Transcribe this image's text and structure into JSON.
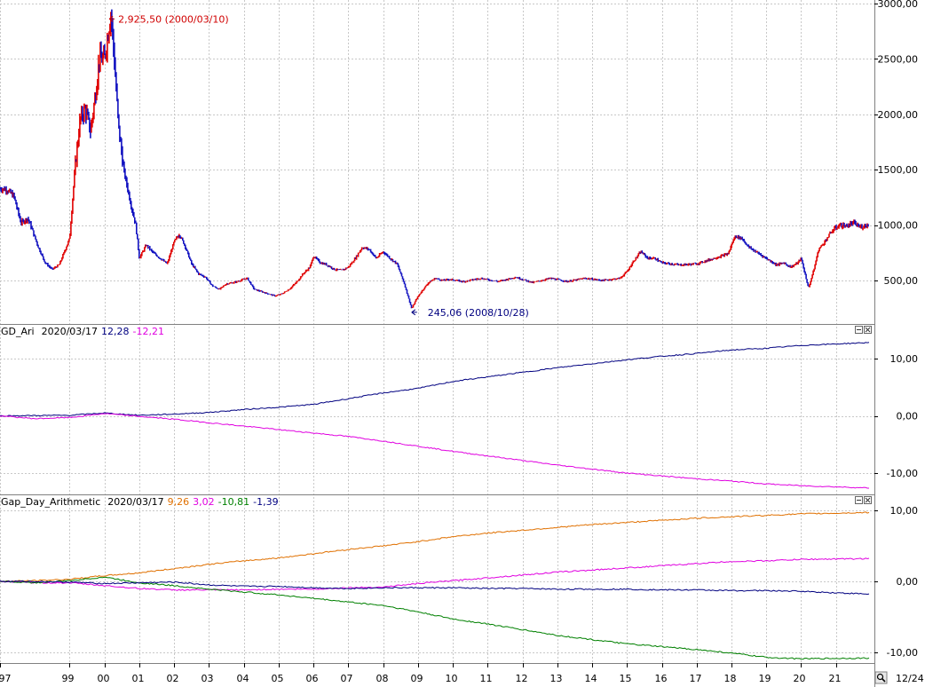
{
  "colors": {
    "grid": "#c8c8c8",
    "up": "#e00000",
    "down": "#1010c0",
    "blue": "#000080",
    "magenta": "#e000e0",
    "orange": "#e07000",
    "green": "#008000",
    "text": "#000000",
    "panel_border": "#808080"
  },
  "footer": {
    "date": "12/24",
    "zoom_icon": "magnifier-icon"
  },
  "chart_data": [
    {
      "type": "candlestick",
      "panel": "price",
      "ylim": [
        200,
        3000
      ],
      "yticks": [
        500,
        1000,
        1500,
        2000,
        2500,
        3000
      ],
      "ytick_labels": [
        "500,00",
        "1000,00",
        "1500,00",
        "2000,00",
        "2500,00",
        "3000,00"
      ],
      "grid": true,
      "x_start": 1997.0,
      "x_end": 2021.95,
      "price_path": [
        [
          1997.0,
          1330
        ],
        [
          1997.2,
          1320
        ],
        [
          1997.4,
          1260
        ],
        [
          1997.6,
          1020
        ],
        [
          1997.8,
          1060
        ],
        [
          1997.9,
          980
        ],
        [
          1998.1,
          800
        ],
        [
          1998.3,
          660
        ],
        [
          1998.5,
          600
        ],
        [
          1998.7,
          640
        ],
        [
          1998.8,
          720
        ],
        [
          1999.0,
          880
        ],
        [
          1999.15,
          1500
        ],
        [
          1999.3,
          1950
        ],
        [
          1999.45,
          2050
        ],
        [
          1999.6,
          1850
        ],
        [
          1999.75,
          2200
        ],
        [
          1999.85,
          2500
        ],
        [
          2000.0,
          2500
        ],
        [
          2000.19,
          2925.5
        ],
        [
          2000.3,
          2400
        ],
        [
          2000.4,
          1900
        ],
        [
          2000.55,
          1500
        ],
        [
          2000.75,
          1200
        ],
        [
          2000.9,
          1000
        ],
        [
          2001.0,
          700
        ],
        [
          2001.2,
          820
        ],
        [
          2001.4,
          750
        ],
        [
          2001.6,
          700
        ],
        [
          2001.8,
          650
        ],
        [
          2002.0,
          850
        ],
        [
          2002.15,
          920
        ],
        [
          2002.3,
          820
        ],
        [
          2002.5,
          650
        ],
        [
          2002.7,
          560
        ],
        [
          2002.9,
          530
        ],
        [
          2003.1,
          450
        ],
        [
          2003.3,
          420
        ],
        [
          2003.5,
          470
        ],
        [
          2003.7,
          480
        ],
        [
          2003.9,
          500
        ],
        [
          2004.1,
          520
        ],
        [
          2004.3,
          420
        ],
        [
          2004.5,
          400
        ],
        [
          2004.7,
          380
        ],
        [
          2004.9,
          360
        ],
        [
          2005.1,
          380
        ],
        [
          2005.3,
          420
        ],
        [
          2005.5,
          480
        ],
        [
          2005.7,
          560
        ],
        [
          2005.9,
          620
        ],
        [
          2006.0,
          720
        ],
        [
          2006.2,
          660
        ],
        [
          2006.4,
          640
        ],
        [
          2006.6,
          600
        ],
        [
          2006.8,
          590
        ],
        [
          2007.0,
          620
        ],
        [
          2007.2,
          700
        ],
        [
          2007.4,
          800
        ],
        [
          2007.6,
          780
        ],
        [
          2007.8,
          700
        ],
        [
          2008.0,
          760
        ],
        [
          2008.2,
          700
        ],
        [
          2008.4,
          650
        ],
        [
          2008.6,
          480
        ],
        [
          2008.82,
          245.06
        ],
        [
          2008.95,
          330
        ],
        [
          2009.1,
          400
        ],
        [
          2009.3,
          480
        ],
        [
          2009.5,
          520
        ],
        [
          2009.7,
          500
        ],
        [
          2009.9,
          510
        ],
        [
          2010.3,
          490
        ],
        [
          2010.8,
          520
        ],
        [
          2011.3,
          490
        ],
        [
          2011.8,
          530
        ],
        [
          2012.3,
          480
        ],
        [
          2012.8,
          520
        ],
        [
          2013.3,
          490
        ],
        [
          2013.8,
          520
        ],
        [
          2014.3,
          500
        ],
        [
          2014.8,
          520
        ],
        [
          2015.0,
          580
        ],
        [
          2015.2,
          680
        ],
        [
          2015.4,
          760
        ],
        [
          2015.6,
          700
        ],
        [
          2015.8,
          700
        ],
        [
          2016.0,
          660
        ],
        [
          2016.5,
          640
        ],
        [
          2017.0,
          650
        ],
        [
          2017.5,
          700
        ],
        [
          2017.9,
          740
        ],
        [
          2018.1,
          900
        ],
        [
          2018.3,
          880
        ],
        [
          2018.5,
          800
        ],
        [
          2018.7,
          760
        ],
        [
          2018.9,
          720
        ],
        [
          2019.1,
          680
        ],
        [
          2019.3,
          640
        ],
        [
          2019.5,
          660
        ],
        [
          2019.7,
          620
        ],
        [
          2019.9,
          660
        ],
        [
          2020.0,
          700
        ],
        [
          2020.21,
          430
        ],
        [
          2020.35,
          580
        ],
        [
          2020.5,
          780
        ],
        [
          2020.7,
          860
        ],
        [
          2020.9,
          950
        ],
        [
          2021.1,
          1000
        ],
        [
          2021.3,
          990
        ],
        [
          2021.5,
          1020
        ],
        [
          2021.7,
          980
        ],
        [
          2021.95,
          1010
        ]
      ],
      "annotations": [
        {
          "text": "2,925,50 (2000/03/10)",
          "x": 2000.19,
          "y": 2925.5,
          "color": "#d00000"
        },
        {
          "text": "245,06 (2008/10/28)",
          "x": 2008.82,
          "y": 245.06,
          "color": "#000080"
        }
      ]
    },
    {
      "type": "line",
      "panel": "indicator1",
      "title": "GD_Ari",
      "date": "2020/03/17",
      "values_text": [
        "12,28",
        "-12,21"
      ],
      "value_colors": [
        "#000080",
        "#e000e0"
      ],
      "ylim": [
        -13.5,
        14.5
      ],
      "yticks": [
        -10,
        0,
        10
      ],
      "ytick_labels": [
        "-10,00",
        "0,00",
        "10,00"
      ],
      "series": [
        {
          "color": "#000080",
          "points": [
            [
              1997.0,
              0
            ],
            [
              1999.0,
              0.1
            ],
            [
              2000.0,
              0.5
            ],
            [
              2001.0,
              0.1
            ],
            [
              2002.0,
              0.3
            ],
            [
              2003.0,
              0.6
            ],
            [
              2004.0,
              1.1
            ],
            [
              2005.0,
              1.5
            ],
            [
              2006.0,
              2.0
            ],
            [
              2007.0,
              3.0
            ],
            [
              2008.0,
              4.0
            ],
            [
              2009.0,
              4.8
            ],
            [
              2010.0,
              6.0
            ],
            [
              2011.0,
              6.8
            ],
            [
              2012.0,
              7.6
            ],
            [
              2013.0,
              8.4
            ],
            [
              2014.0,
              9.1
            ],
            [
              2015.0,
              9.8
            ],
            [
              2016.0,
              10.4
            ],
            [
              2017.0,
              10.9
            ],
            [
              2018.0,
              11.5
            ],
            [
              2019.0,
              11.8
            ],
            [
              2020.0,
              12.3
            ],
            [
              2021.95,
              12.8
            ]
          ]
        },
        {
          "color": "#e000e0",
          "points": [
            [
              1997.0,
              0
            ],
            [
              1998.0,
              -0.5
            ],
            [
              1999.0,
              -0.3
            ],
            [
              2000.0,
              0.4
            ],
            [
              2001.0,
              -0.1
            ],
            [
              2002.0,
              -0.6
            ],
            [
              2003.0,
              -1.2
            ],
            [
              2004.0,
              -1.8
            ],
            [
              2005.0,
              -2.4
            ],
            [
              2006.0,
              -3.0
            ],
            [
              2007.0,
              -3.6
            ],
            [
              2008.0,
              -4.4
            ],
            [
              2009.0,
              -5.3
            ],
            [
              2010.0,
              -6.2
            ],
            [
              2011.0,
              -7.0
            ],
            [
              2012.0,
              -7.8
            ],
            [
              2013.0,
              -8.6
            ],
            [
              2014.0,
              -9.3
            ],
            [
              2015.0,
              -10.0
            ],
            [
              2016.0,
              -10.5
            ],
            [
              2017.0,
              -11.0
            ],
            [
              2018.0,
              -11.4
            ],
            [
              2019.0,
              -11.9
            ],
            [
              2020.0,
              -12.2
            ],
            [
              2021.95,
              -12.6
            ]
          ]
        }
      ]
    },
    {
      "type": "line",
      "panel": "indicator2",
      "title": "Gap_Day_Arithmetic",
      "date": "2020/03/17",
      "values_text": [
        "9,26",
        "3,02",
        "-10,81",
        "-1,39"
      ],
      "value_colors": [
        "#e07000",
        "#e000e0",
        "#008000",
        "#000080"
      ],
      "ylim": [
        -11.5,
        10.5
      ],
      "yticks": [
        -10,
        0,
        10
      ],
      "ytick_labels": [
        "-10,00",
        "0,00",
        "10,00"
      ],
      "series": [
        {
          "color": "#e07000",
          "points": [
            [
              1997.0,
              0
            ],
            [
              1998.0,
              0.1
            ],
            [
              1999.0,
              0.3
            ],
            [
              2000.0,
              0.8
            ],
            [
              2001.0,
              1.2
            ],
            [
              2002.0,
              1.8
            ],
            [
              2003.0,
              2.4
            ],
            [
              2004.0,
              2.9
            ],
            [
              2005.0,
              3.3
            ],
            [
              2006.0,
              3.9
            ],
            [
              2007.0,
              4.5
            ],
            [
              2008.0,
              5.0
            ],
            [
              2009.0,
              5.6
            ],
            [
              2010.0,
              6.3
            ],
            [
              2011.0,
              6.8
            ],
            [
              2012.0,
              7.2
            ],
            [
              2013.0,
              7.6
            ],
            [
              2014.0,
              8.0
            ],
            [
              2015.0,
              8.3
            ],
            [
              2016.0,
              8.6
            ],
            [
              2017.0,
              8.9
            ],
            [
              2018.0,
              9.1
            ],
            [
              2019.0,
              9.3
            ],
            [
              2020.0,
              9.5
            ],
            [
              2021.95,
              9.7
            ]
          ]
        },
        {
          "color": "#e000e0",
          "points": [
            [
              1997.0,
              0
            ],
            [
              1998.0,
              -0.2
            ],
            [
              1999.0,
              -0.2
            ],
            [
              2000.0,
              -0.6
            ],
            [
              2001.0,
              -1.0
            ],
            [
              2002.0,
              -1.2
            ],
            [
              2003.0,
              -1.2
            ],
            [
              2004.0,
              -1.2
            ],
            [
              2005.0,
              -1.1
            ],
            [
              2006.0,
              -1.1
            ],
            [
              2007.0,
              -0.9
            ],
            [
              2008.0,
              -0.8
            ],
            [
              2009.0,
              -0.3
            ],
            [
              2010.0,
              0.1
            ],
            [
              2011.0,
              0.5
            ],
            [
              2012.0,
              0.9
            ],
            [
              2013.0,
              1.3
            ],
            [
              2014.0,
              1.6
            ],
            [
              2015.0,
              1.9
            ],
            [
              2016.0,
              2.2
            ],
            [
              2017.0,
              2.5
            ],
            [
              2018.0,
              2.8
            ],
            [
              2019.0,
              2.9
            ],
            [
              2020.0,
              3.1
            ],
            [
              2021.95,
              3.2
            ]
          ]
        },
        {
          "color": "#008000",
          "points": [
            [
              1997.0,
              0
            ],
            [
              1998.0,
              -0.2
            ],
            [
              1999.0,
              0.1
            ],
            [
              2000.0,
              0.6
            ],
            [
              2001.0,
              -0.2
            ],
            [
              2002.0,
              -0.6
            ],
            [
              2003.0,
              -1.1
            ],
            [
              2004.0,
              -1.5
            ],
            [
              2005.0,
              -1.9
            ],
            [
              2006.0,
              -2.4
            ],
            [
              2007.0,
              -2.9
            ],
            [
              2008.0,
              -3.4
            ],
            [
              2009.0,
              -4.3
            ],
            [
              2010.0,
              -5.3
            ],
            [
              2011.0,
              -6.0
            ],
            [
              2012.0,
              -6.8
            ],
            [
              2013.0,
              -7.6
            ],
            [
              2014.0,
              -8.2
            ],
            [
              2015.0,
              -8.8
            ],
            [
              2016.0,
              -9.2
            ],
            [
              2017.0,
              -9.6
            ],
            [
              2018.0,
              -10.1
            ],
            [
              2019.0,
              -10.7
            ],
            [
              2020.0,
              -10.9
            ],
            [
              2021.95,
              -10.8
            ]
          ]
        },
        {
          "color": "#000080",
          "points": [
            [
              1997.0,
              0
            ],
            [
              1998.0,
              0
            ],
            [
              1999.0,
              -0.1
            ],
            [
              2000.0,
              -0.3
            ],
            [
              2001.0,
              -0.2
            ],
            [
              2002.0,
              -0.1
            ],
            [
              2003.0,
              -0.5
            ],
            [
              2004.0,
              -0.7
            ],
            [
              2005.0,
              -0.7
            ],
            [
              2006.0,
              -0.9
            ],
            [
              2007.0,
              -1.0
            ],
            [
              2008.0,
              -0.9
            ],
            [
              2009.0,
              -0.9
            ],
            [
              2010.0,
              -0.9
            ],
            [
              2011.0,
              -1.0
            ],
            [
              2012.0,
              -1.0
            ],
            [
              2013.0,
              -1.1
            ],
            [
              2014.0,
              -1.1
            ],
            [
              2015.0,
              -1.1
            ],
            [
              2016.0,
              -1.2
            ],
            [
              2017.0,
              -1.2
            ],
            [
              2018.0,
              -1.3
            ],
            [
              2019.0,
              -1.3
            ],
            [
              2020.0,
              -1.4
            ],
            [
              2021.95,
              -1.8
            ]
          ]
        }
      ]
    }
  ],
  "x_axis": {
    "ticks": [
      1997,
      1999,
      2000,
      2001,
      2002,
      2003,
      2004,
      2005,
      2006,
      2007,
      2008,
      2009,
      2010,
      2011,
      2012,
      2013,
      2014,
      2015,
      2016,
      2017,
      2018,
      2019,
      2020,
      2021
    ],
    "labels": [
      "97",
      "99",
      "00",
      "01",
      "02",
      "03",
      "04",
      "05",
      "06",
      "07",
      "08",
      "09",
      "10",
      "11",
      "12",
      "13",
      "14",
      "15",
      "16",
      "17",
      "18",
      "19",
      "20",
      "21"
    ]
  }
}
